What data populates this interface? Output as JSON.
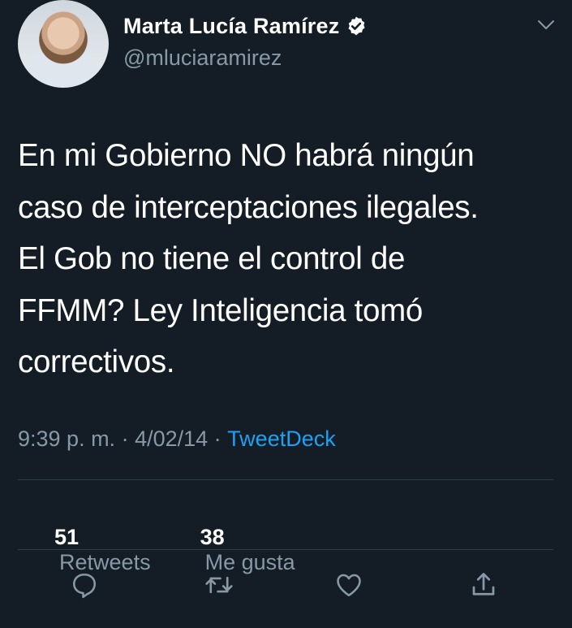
{
  "tweet": {
    "author": {
      "display_name": "Marta Lucía Ramírez",
      "handle": "@mluciaramirez",
      "verified": true
    },
    "text": "En mi Gobierno NO habrá ningún\ncaso de interceptaciones ilegales.\nEl Gob no tiene el control de\nFFMM? Ley Inteligencia tomó\ncorrectivos.",
    "time": "9:39 p. m.",
    "separator": " · ",
    "date": "4/02/14",
    "source": "TweetDeck",
    "stats": {
      "retweets_count": "51",
      "retweets_label": "Retweets",
      "likes_count": "38",
      "likes_label": "Me gusta"
    },
    "actions": [
      "reply-icon",
      "retweet-icon",
      "like-icon",
      "share-icon"
    ]
  },
  "colors": {
    "background": "#141d26",
    "text": "#ffffff",
    "secondary_text": "#8899a6",
    "accent": "#1da1f2",
    "divider": "#2f3d4a"
  }
}
